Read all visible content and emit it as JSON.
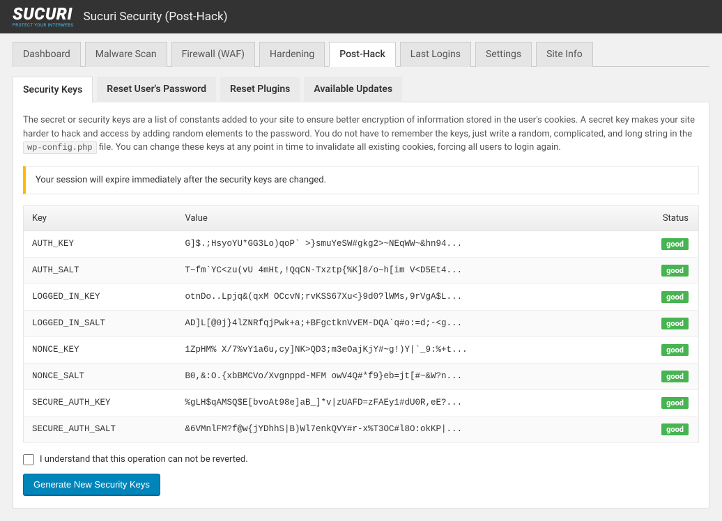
{
  "header": {
    "logo_text": "SUCURI",
    "logo_tagline": "PROTECT YOUR INTERWEBS",
    "page_title": "Sucuri Security (Post-Hack)"
  },
  "tabs": [
    {
      "label": "Dashboard",
      "active": false
    },
    {
      "label": "Malware Scan",
      "active": false
    },
    {
      "label": "Firewall (WAF)",
      "active": false
    },
    {
      "label": "Hardening",
      "active": false
    },
    {
      "label": "Post-Hack",
      "active": true
    },
    {
      "label": "Last Logins",
      "active": false
    },
    {
      "label": "Settings",
      "active": false
    },
    {
      "label": "Site Info",
      "active": false
    }
  ],
  "subtabs": [
    {
      "label": "Security Keys",
      "active": true
    },
    {
      "label": "Reset User's Password",
      "active": false
    },
    {
      "label": "Reset Plugins",
      "active": false
    },
    {
      "label": "Available Updates",
      "active": false
    }
  ],
  "description": {
    "part1": "The secret or security keys are a list of constants added to your site to ensure better encryption of information stored in the user's cookies. A secret key makes your site harder to hack and access by adding random elements to the password. You do not have to remember the keys, just write a random, complicated, and long string in the ",
    "code": "wp-config.php",
    "part2": " file. You can change these keys at any point in time to invalidate all existing cookies, forcing all users to login again."
  },
  "notice": "Your session will expire immediately after the security keys are changed.",
  "table": {
    "headers": {
      "key": "Key",
      "value": "Value",
      "status": "Status"
    },
    "rows": [
      {
        "key": "AUTH_KEY",
        "value": "G]$.;HsyoYU*GG3Lo)qoP` >}smuYeSW#gkg2>~NEqWW~&hn94...",
        "status": "good"
      },
      {
        "key": "AUTH_SALT",
        "value": "T~fm`YC<zu(vU 4mHt,!QqCN-Txztp{%K]8/o~h[im V<D5Et4...",
        "status": "good"
      },
      {
        "key": "LOGGED_IN_KEY",
        "value": "otnDo..Lpjq&(qxM OCcvN;rvKSS67Xu<}9d0?lWMs,9rVgA$L...",
        "status": "good"
      },
      {
        "key": "LOGGED_IN_SALT",
        "value": "AD]L[@0j}4lZNRfqjPwk+a;+BFgctknVvEM-DQA`q#o:=d;-<g...",
        "status": "good"
      },
      {
        "key": "NONCE_KEY",
        "value": "1ZpHM% X/7%vY1a6u,cy]NK>QD3;m3eOajKjY#~g!)Y|`_9:%+t...",
        "status": "good"
      },
      {
        "key": "NONCE_SALT",
        "value": "B0,&:O.{xbBMCVo/Xvgnppd-MFM owV4Q#*f9}eb=jt[#~&W?n...",
        "status": "good"
      },
      {
        "key": "SECURE_AUTH_KEY",
        "value": "%gLH$qAMSQ$E[bvoAt98e]aB_]*v|zUAFD=zFAEy1#dU0R,eE?...",
        "status": "good"
      },
      {
        "key": "SECURE_AUTH_SALT",
        "value": "&6VMnlFM?f@w{jYDhhS|B)Wl7enkQVY#r-x%T3OC#l8O:okKP|...",
        "status": "good"
      }
    ]
  },
  "confirmation_label": "I understand that this operation can not be reverted.",
  "button_label": "Generate New Security Keys"
}
